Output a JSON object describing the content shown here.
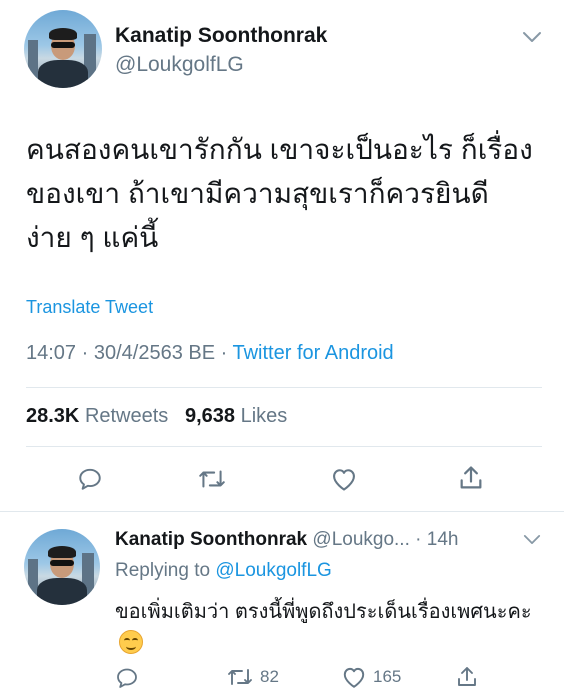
{
  "tweet": {
    "author_name": "Kanatip Soonthonrak",
    "author_handle": "@LoukgolfLG",
    "text": "คนสองคนเขารักกัน เขาจะเป็นอะไร ก็เรื่องของเขา ถ้าเขามีความสุขเราก็ควรยินดี ง่าย ๆ แค่นี้",
    "translate_label": "Translate Tweet",
    "time": "14:07",
    "date": "30/4/2563 BE",
    "source": "Twitter for Android",
    "retweets_count": "28.3K",
    "retweets_label": "Retweets",
    "likes_count": "9,638",
    "likes_label": "Likes"
  },
  "reply": {
    "author_name": "Kanatip Soonthonrak",
    "author_handle": "@Loukgo...",
    "age": "14h",
    "replying_prefix": "Replying to",
    "replying_to": "@LoukgolfLG",
    "text": "ขอเพิ่มเติมว่า ตรงนี้พี่พูดถึงประเด็นเรื่องเพศนะคะ",
    "retweet_count": "82",
    "like_count": "165"
  },
  "colors": {
    "link": "#1b95e0",
    "muted": "#657786",
    "text": "#14171a",
    "divider": "#e1e8ed"
  },
  "icons": [
    "chevron-down-icon",
    "reply-icon",
    "retweet-icon",
    "like-icon",
    "share-icon",
    "smiling-face-emoji"
  ]
}
